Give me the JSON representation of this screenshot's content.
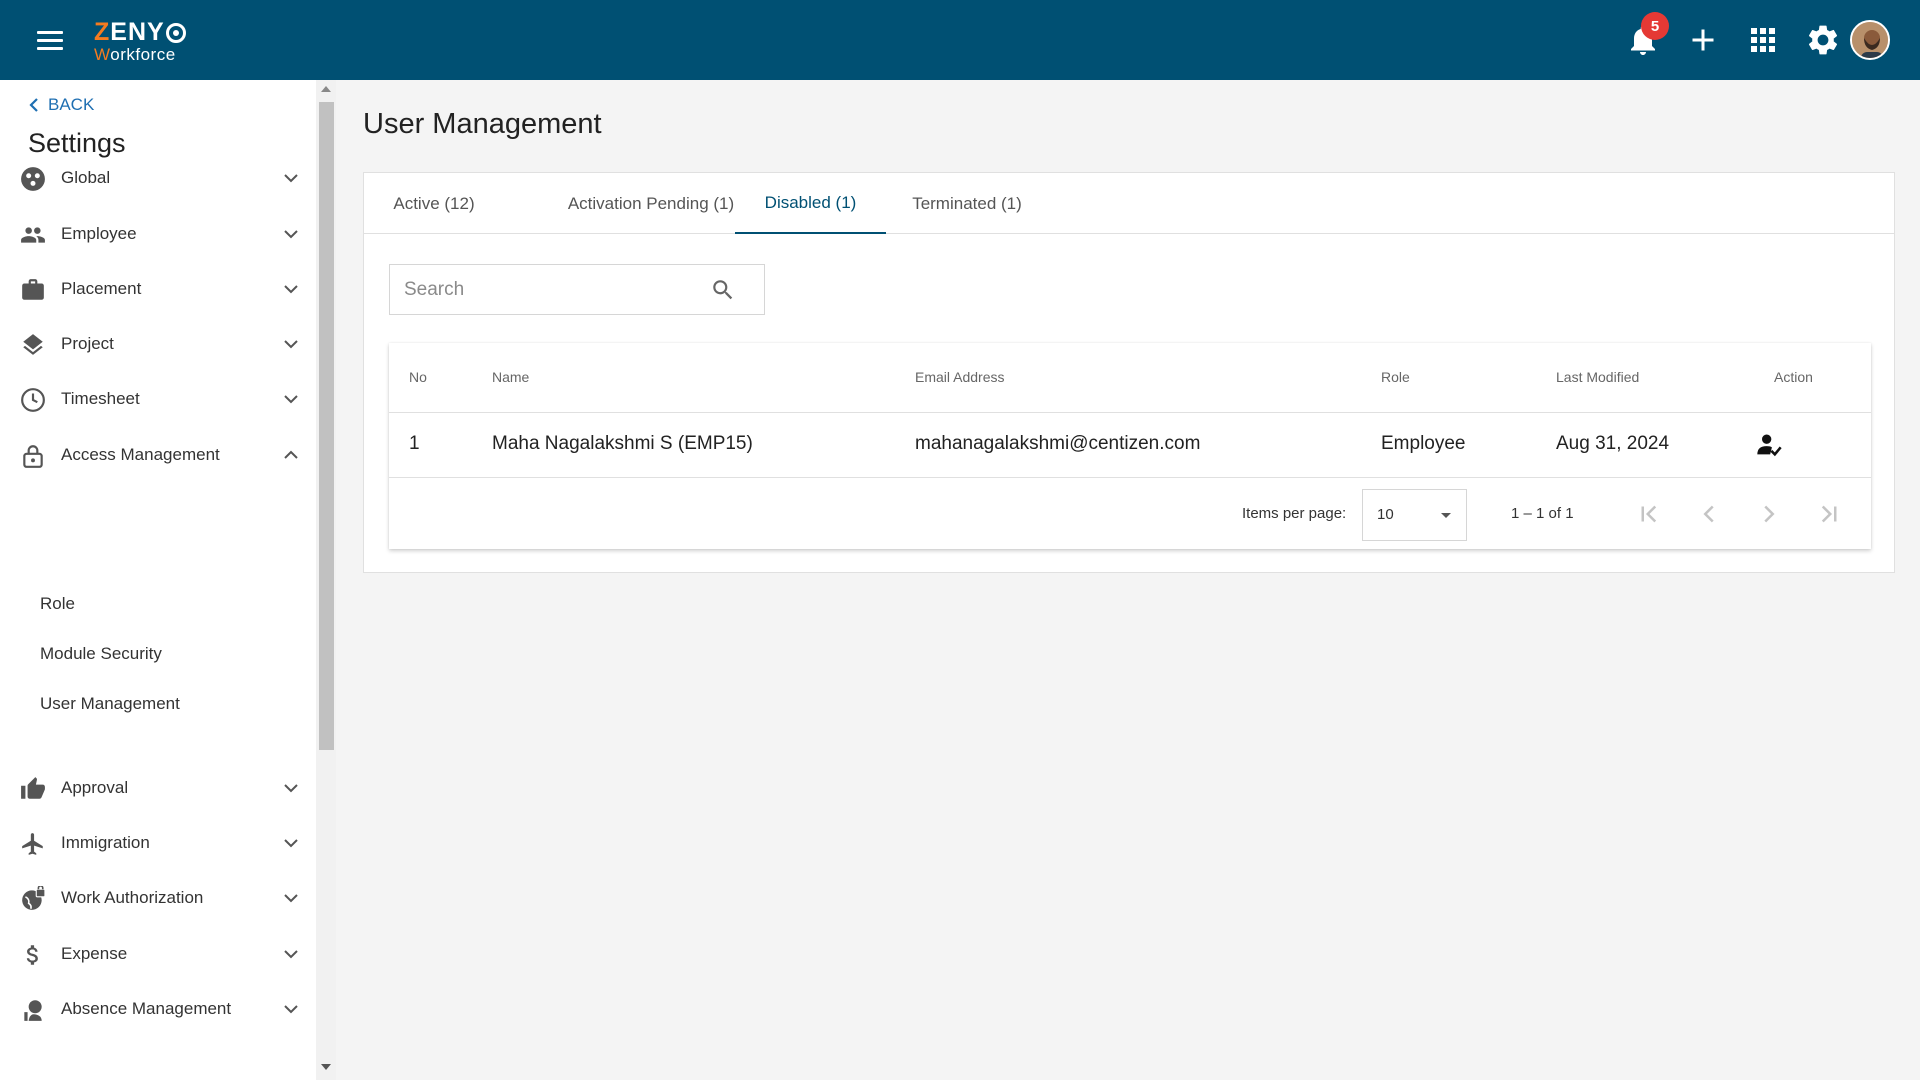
{
  "header": {
    "logo_zeny": "ZENY",
    "logo_z": "Z",
    "logo_rest": "ENY",
    "logo_workforce_w": "W",
    "logo_workforce_rest": "orkforce",
    "notification_count": "5",
    "brand_color": "#005073",
    "accent_color": "#f47b20",
    "icons": [
      "menu-icon",
      "bell-icon",
      "plus-icon",
      "apps-grid-icon",
      "gear-icon",
      "avatar"
    ]
  },
  "sidebar": {
    "back_label": "BACK",
    "title": "Settings",
    "items": [
      {
        "label": "Global",
        "icon": "globe-dots-icon",
        "expanded": false
      },
      {
        "label": "Employee",
        "icon": "people-icon",
        "expanded": false
      },
      {
        "label": "Placement",
        "icon": "briefcase-icon",
        "expanded": false
      },
      {
        "label": "Project",
        "icon": "layers-icon",
        "expanded": false
      },
      {
        "label": "Timesheet",
        "icon": "clock-icon",
        "expanded": false
      },
      {
        "label": "Access Management",
        "icon": "lock-icon",
        "expanded": true
      },
      {
        "label": "Approval",
        "icon": "thumb-up-icon",
        "expanded": false
      },
      {
        "label": "Immigration",
        "icon": "airplane-icon",
        "expanded": false
      },
      {
        "label": "Work Authorization",
        "icon": "globe-lock-icon",
        "expanded": false
      },
      {
        "label": "Expense",
        "icon": "dollar-icon",
        "expanded": false
      },
      {
        "label": "Absence Management",
        "icon": "person-leave-icon",
        "expanded": false
      }
    ],
    "access_management_children": [
      "Role",
      "Module Security",
      "User Management"
    ]
  },
  "main": {
    "title": "User Management",
    "tabs": [
      {
        "label": "Active (12)",
        "active": false
      },
      {
        "label": "Activation Pending (1)",
        "active": false
      },
      {
        "label": "Disabled (1)",
        "active": true
      },
      {
        "label": "Terminated (1)",
        "active": false
      }
    ],
    "search": {
      "placeholder": "Search",
      "value": ""
    },
    "table": {
      "columns": [
        "No",
        "Name",
        "Email Address",
        "Role",
        "Last Modified",
        "Action"
      ],
      "rows": [
        [
          "1",
          "Maha Nagalakshmi S (EMP15)",
          "mahanagalakshmi@centizen.com",
          "Employee",
          "Aug 31, 2024"
        ]
      ],
      "row_action_icon": "enable-user-icon"
    },
    "paginator": {
      "items_per_page_label": "Items per page:",
      "items_per_page_value": "10",
      "range_label": "1 – 1 of 1"
    }
  }
}
